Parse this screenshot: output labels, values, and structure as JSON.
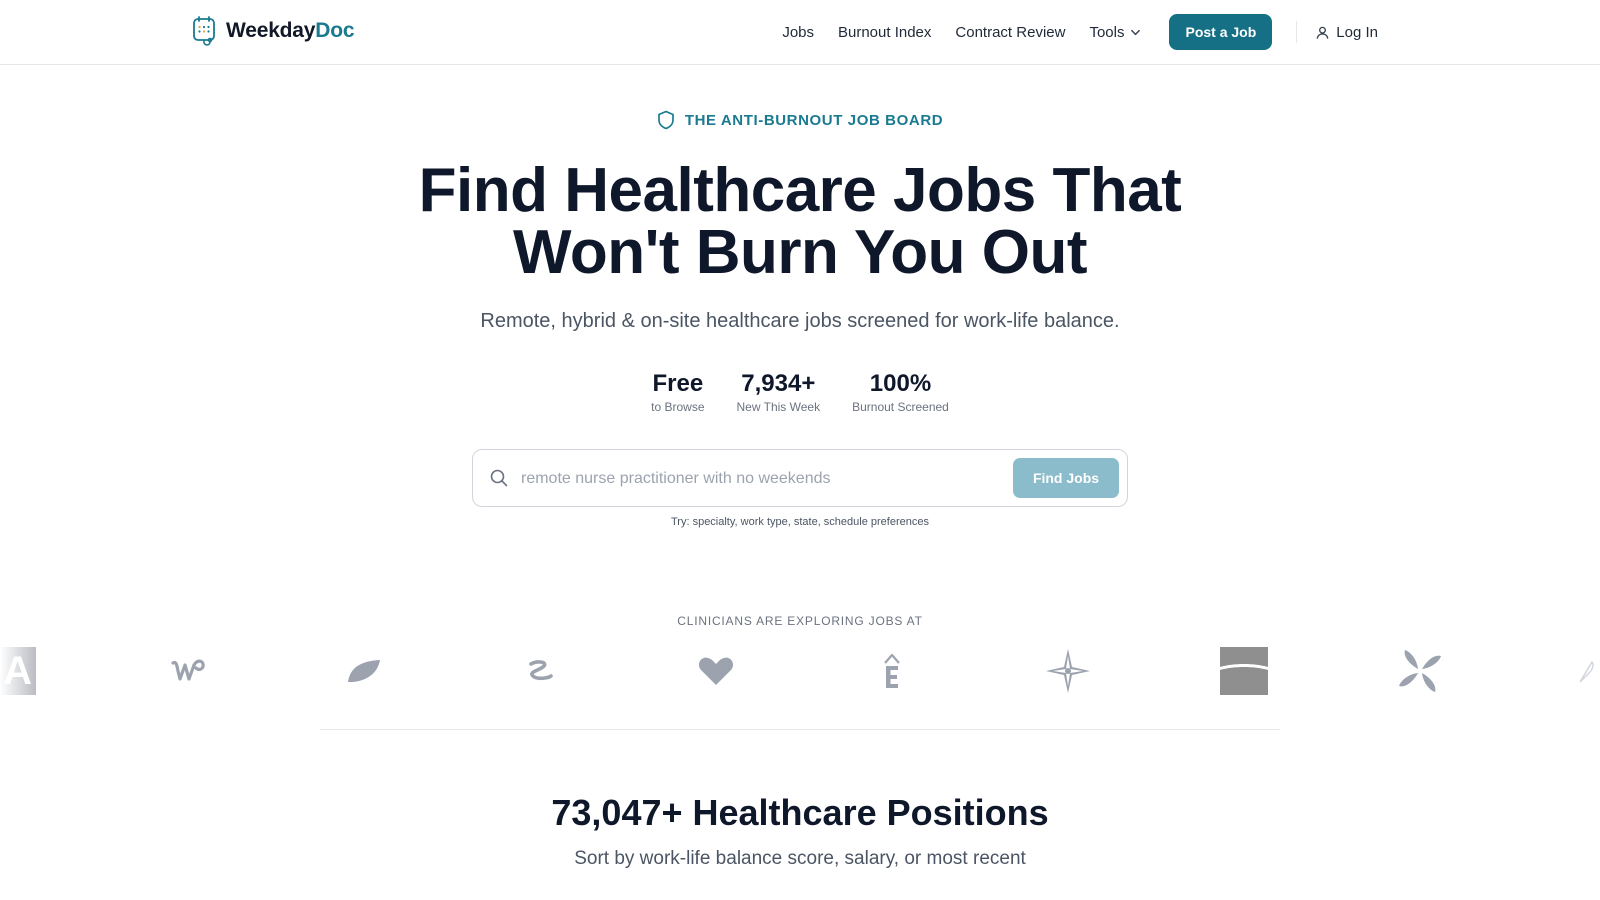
{
  "nav": {
    "brand_part1": "Weekday",
    "brand_part2": "Doc",
    "links": [
      "Jobs",
      "Burnout Index",
      "Contract Review",
      "Tools"
    ],
    "post_job": "Post a Job",
    "login": "Log In"
  },
  "hero": {
    "eyebrow": "THE ANTI-BURNOUT JOB BOARD",
    "title_line1": "Find Healthcare Jobs That",
    "title_line2": "Won't Burn You Out",
    "subtitle": "Remote, hybrid & on-site healthcare jobs screened for work-life balance.",
    "stats": [
      {
        "value": "Free",
        "label": "to Browse"
      },
      {
        "value": "7,934+",
        "label": "New This Week"
      },
      {
        "value": "100%",
        "label": "Burnout Screened"
      }
    ],
    "search_placeholder": "remote nurse practitioner with no weekends",
    "search_button": "Find Jobs",
    "hint": "Try: specialty, work type, state, schedule preferences"
  },
  "logos": {
    "title": "CLINICIANS ARE EXPLORING JOBS AT",
    "partial_letter": "A"
  },
  "section": {
    "title": "73,047+ Healthcare Positions",
    "subtitle": "Sort by work-life balance score, salary, or most recent"
  },
  "colors": {
    "brand_teal": "#1a7a90",
    "button_teal": "#156f85",
    "find_button_disabled": "#8bbccb",
    "logo_gray": "#9ca3af"
  }
}
